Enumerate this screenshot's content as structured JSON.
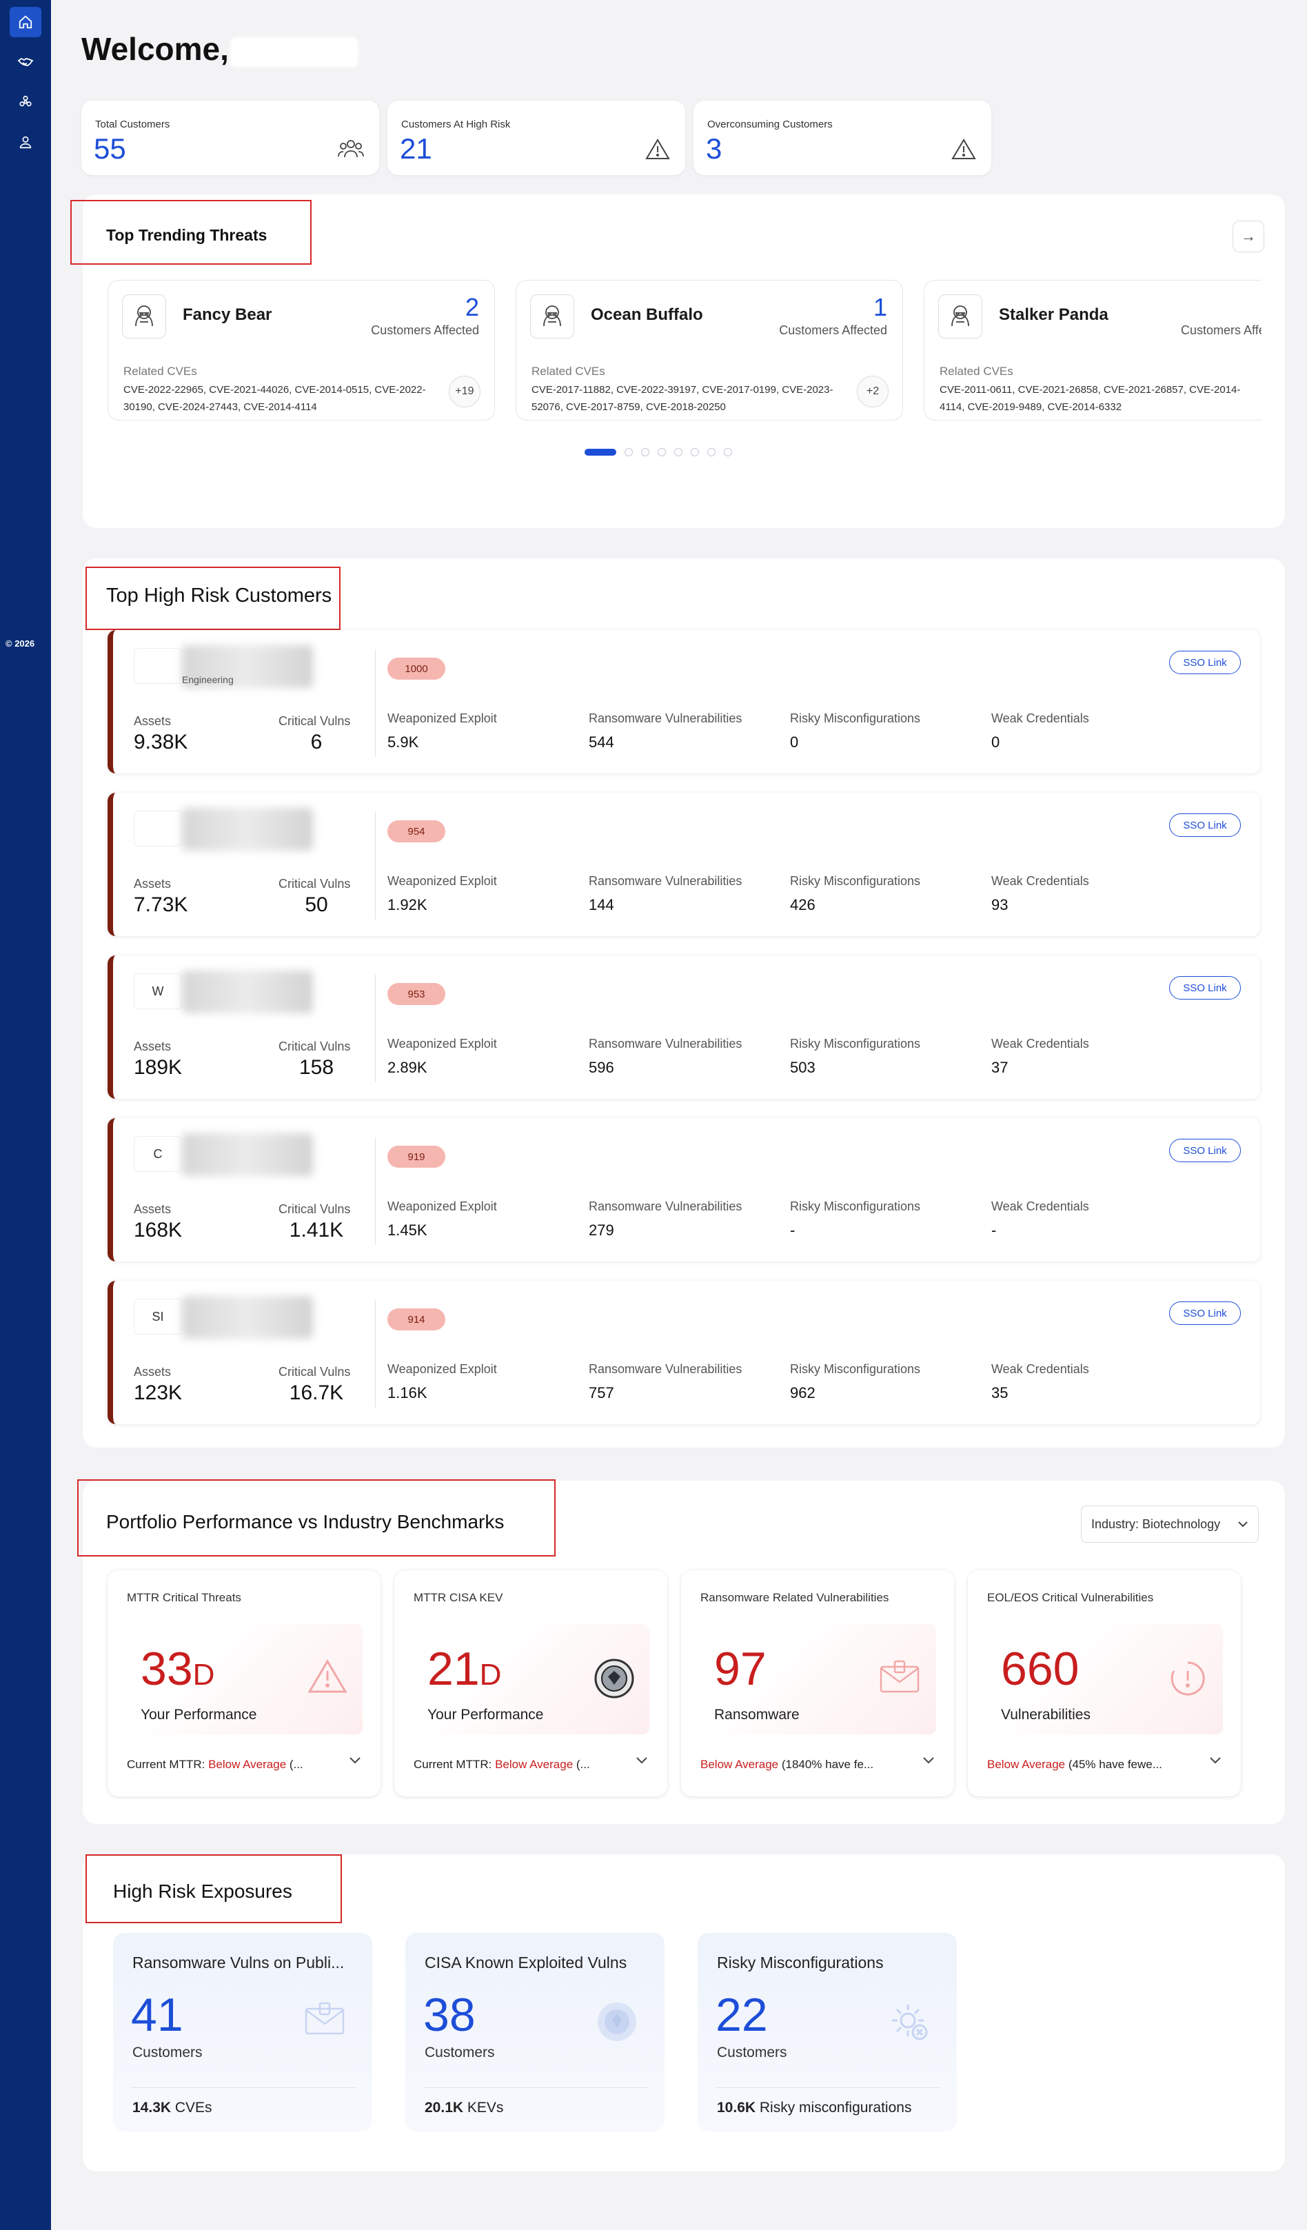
{
  "footer": {
    "copyright": "© 2026"
  },
  "welcome": {
    "text": "Welcome,"
  },
  "stats": [
    {
      "label": "Total Customers",
      "value": "55",
      "icon": "users-icon"
    },
    {
      "label": "Customers At High Risk",
      "value": "21",
      "icon": "warning-icon"
    },
    {
      "label": "Overconsuming Customers",
      "value": "3",
      "icon": "warning-icon"
    }
  ],
  "threats": {
    "title": "Top Trending Threats",
    "next_arrow": "→",
    "cards": [
      {
        "name": "Fancy Bear",
        "count": "2",
        "affected_label": "Customers Affected",
        "related_label": "Related CVEs",
        "cves": "CVE-2022-22965, CVE-2021-44026, CVE-2014-0515, CVE-2022-30190, CVE-2024-27443, CVE-2014-4114",
        "more": "+19"
      },
      {
        "name": "Ocean Buffalo",
        "count": "1",
        "affected_label": "Customers Affected",
        "related_label": "Related CVEs",
        "cves": "CVE-2017-11882, CVE-2022-39197, CVE-2017-0199, CVE-2023-52076, CVE-2017-8759, CVE-2018-20250",
        "more": "+2"
      },
      {
        "name": "Stalker Panda",
        "count": "",
        "affected_label": "Customers Affe",
        "related_label": "Related CVEs",
        "cves": "CVE-2011-0611, CVE-2021-26858, CVE-2021-26857, CVE-2014-4114, CVE-2019-9489, CVE-2014-6332",
        "more": ""
      }
    ]
  },
  "high_risk": {
    "title": "Top High Risk Customers",
    "labels": {
      "assets": "Assets",
      "critical": "Critical Vulns",
      "weaponized": "Weaponized Exploit",
      "ransomware": "Ransomware Vulnerabilities",
      "misconfig": "Risky Misconfigurations",
      "weak": "Weak Credentials",
      "sso": "SSO Link"
    },
    "customers": [
      {
        "logo": "",
        "sub": "Engineering",
        "score": "1000",
        "assets": "9.38K",
        "critical": "6",
        "weaponized": "5.9K",
        "ransomware": "544",
        "misconfig": "0",
        "weak": "0"
      },
      {
        "logo": "",
        "sub": "",
        "score": "954",
        "assets": "7.73K",
        "critical": "50",
        "weaponized": "1.92K",
        "ransomware": "144",
        "misconfig": "426",
        "weak": "93"
      },
      {
        "logo": "W",
        "sub": "",
        "score": "953",
        "assets": "189K",
        "critical": "158",
        "weaponized": "2.89K",
        "ransomware": "596",
        "misconfig": "503",
        "weak": "37"
      },
      {
        "logo": "C",
        "sub": "",
        "score": "919",
        "assets": "168K",
        "critical": "1.41K",
        "weaponized": "1.45K",
        "ransomware": "279",
        "misconfig": "-",
        "weak": "-"
      },
      {
        "logo": "SI",
        "sub": "",
        "score": "914",
        "assets": "123K",
        "critical": "16.7K",
        "weaponized": "1.16K",
        "ransomware": "757",
        "misconfig": "962",
        "weak": "35"
      }
    ]
  },
  "portfolio": {
    "title": "Portfolio Performance vs Industry Benchmarks",
    "industry": "Industry: Biotechnology",
    "cards": [
      {
        "title": "MTTR Critical Threats",
        "value": "33",
        "unit": "D",
        "sub": "Your Performance",
        "foot_prefix": "Current MTTR: ",
        "foot_status": "Below Average",
        "foot_rest": " (...",
        "icon": "warning-icon"
      },
      {
        "title": "MTTR CISA KEV",
        "value": "21",
        "unit": "D",
        "sub": "Your Performance",
        "foot_prefix": "Current MTTR: ",
        "foot_status": "Below Average",
        "foot_rest": " (...",
        "icon": "cisa-seal-icon"
      },
      {
        "title": "Ransomware Related Vulnerabilities",
        "value": "97",
        "unit": "",
        "sub": "Ransomware",
        "foot_prefix": "",
        "foot_status": "Below Average",
        "foot_rest": " (1840% have fe...",
        "icon": "ransom-envelope-icon"
      },
      {
        "title": "EOL/EOS Critical Vulnerabilities",
        "value": "660",
        "unit": "",
        "sub": "Vulnerabilities",
        "foot_prefix": "",
        "foot_status": "Below Average",
        "foot_rest": " (45% have fewe...",
        "icon": "clock-alert-icon"
      }
    ]
  },
  "exposures": {
    "title": "High Risk Exposures",
    "cards": [
      {
        "title": "Ransomware Vulns on Publi...",
        "value": "41",
        "sub": "Customers",
        "foot_bold": "14.3K",
        "foot_rest": " CVEs",
        "icon": "ransom-envelope-icon"
      },
      {
        "title": "CISA Known Exploited Vulns",
        "value": "38",
        "sub": "Customers",
        "foot_bold": "20.1K",
        "foot_rest": " KEVs",
        "icon": "cisa-seal-icon"
      },
      {
        "title": "Risky Misconfigurations",
        "value": "22",
        "sub": "Customers",
        "foot_bold": "10.6K",
        "foot_rest": " Risky misconfigurations",
        "icon": "gear-x-icon"
      }
    ]
  },
  "colors": {
    "sidebar": "#082b73",
    "accent": "#1d4ed8",
    "danger": "#c81e1e",
    "risk_border": "#7a1f10"
  }
}
